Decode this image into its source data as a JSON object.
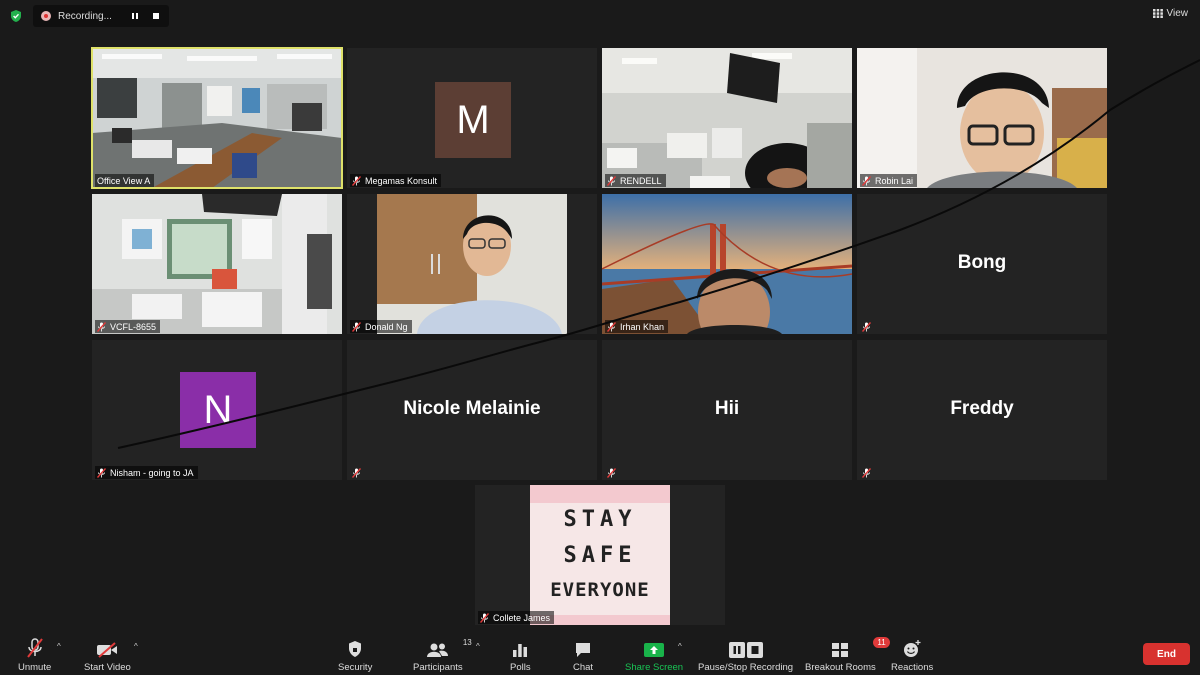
{
  "recording": {
    "label": "Recording..."
  },
  "view": {
    "label": "View"
  },
  "tiles": [
    {
      "name": "Office View A"
    },
    {
      "name": "Megamas Konsult",
      "initial": "M"
    },
    {
      "name": "RENDELL"
    },
    {
      "name": "Robin Lai"
    },
    {
      "name": "VCFL-8655"
    },
    {
      "name": "Donald Ng"
    },
    {
      "name": "Irhan Khan"
    },
    {
      "name": "Bong"
    },
    {
      "name": "Nisham - going to JA",
      "initial": "N"
    },
    {
      "name": "Nicole Melainie"
    },
    {
      "name": "Hii"
    },
    {
      "name": "Freddy"
    },
    {
      "name": "Collete James",
      "sign_lines": [
        "STAY",
        "SAFE",
        "EVERYONE"
      ]
    }
  ],
  "toolbar": {
    "unmute": "Unmute",
    "start_video": "Start Video",
    "security": "Security",
    "participants": "Participants",
    "participants_count": "13",
    "polls": "Polls",
    "chat": "Chat",
    "share_screen": "Share Screen",
    "pause_stop_recording": "Pause/Stop Recording",
    "breakout_rooms": "Breakout Rooms",
    "breakout_count": "11",
    "reactions": "Reactions",
    "end": "End"
  },
  "colors": {
    "active_outline": "#dfe26a",
    "share_green": "#19b34a",
    "end_red": "#d8322f",
    "megamas_avatar": "#5c3e34",
    "nisham_avatar": "#8a2ea8"
  }
}
